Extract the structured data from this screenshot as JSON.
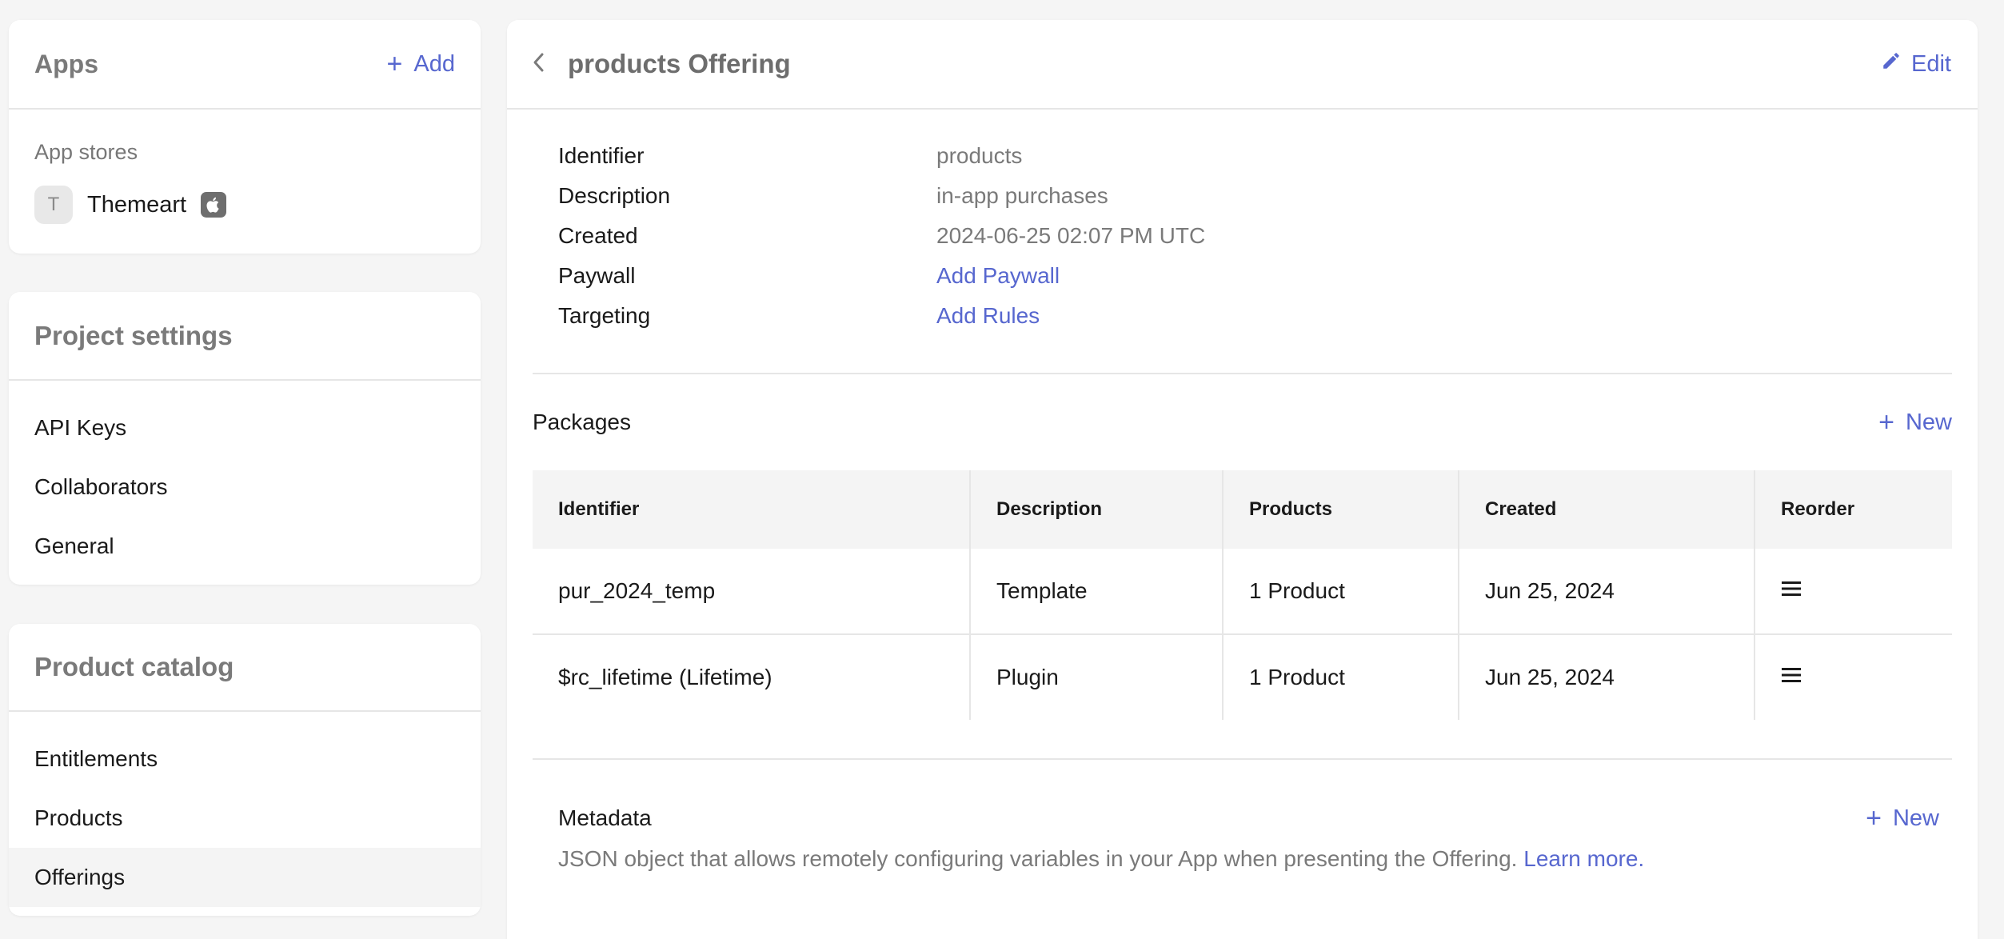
{
  "sidebar": {
    "apps": {
      "title": "Apps",
      "add_label": "Add",
      "app_stores_label": "App stores",
      "app": {
        "avatar_letter": "T",
        "name": "Themeart",
        "platform_icon": "apple-icon"
      }
    },
    "project_settings": {
      "title": "Project settings",
      "items": [
        {
          "label": "API Keys"
        },
        {
          "label": "Collaborators"
        },
        {
          "label": "General"
        }
      ]
    },
    "product_catalog": {
      "title": "Product catalog",
      "items": [
        {
          "label": "Entitlements"
        },
        {
          "label": "Products"
        },
        {
          "label": "Offerings",
          "active": true
        }
      ]
    }
  },
  "main": {
    "title": "products Offering",
    "edit_label": "Edit",
    "details": [
      {
        "key": "Identifier",
        "value": "products"
      },
      {
        "key": "Description",
        "value": "in-app purchases"
      },
      {
        "key": "Created",
        "value": "2024-06-25 02:07 PM UTC"
      },
      {
        "key": "Paywall",
        "value": "Add Paywall"
      },
      {
        "key": "Targeting",
        "value": "Add Rules"
      }
    ],
    "packages": {
      "title": "Packages",
      "new_label": "New",
      "columns": [
        "Identifier",
        "Description",
        "Products",
        "Created",
        "Reorder"
      ],
      "rows": [
        {
          "identifier": "pur_2024_temp",
          "description": "Template",
          "products": "1 Product",
          "created": "Jun 25, 2024"
        },
        {
          "identifier": "$rc_lifetime (Lifetime)",
          "description": "Plugin",
          "products": "1 Product",
          "created": "Jun 25, 2024"
        }
      ]
    },
    "metadata": {
      "title": "Metadata",
      "new_label": "New",
      "description": "JSON object that allows remotely configuring variables in your App when presenting the Offering.",
      "learn_more": "Learn more."
    }
  },
  "colors": {
    "accent": "#5767cf",
    "background": "#f5f5f5",
    "card": "#ffffff",
    "muted_text": "#7a7a7a",
    "border": "#e6e6e6"
  }
}
